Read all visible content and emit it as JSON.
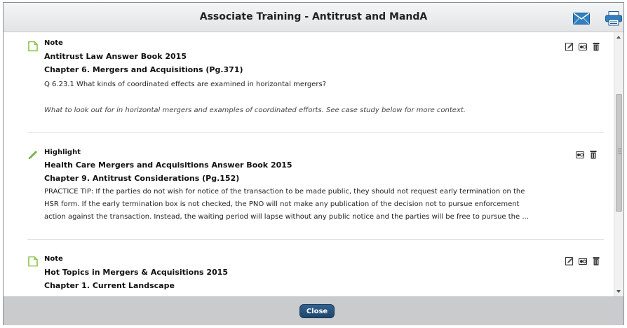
{
  "dialog": {
    "title": "Associate Training - Antitrust and MandA",
    "icons": {
      "email": "mail-icon",
      "print": "printer-icon"
    }
  },
  "entries": [
    {
      "type": "Note",
      "icon": "note-icon",
      "book": "Antitrust Law Answer Book 2015",
      "chapter": "Chapter 6. Mergers and Acquisitions (Pg.371)",
      "quote_lines": [
        "Q 6.23.1 What kinds of coordinated effects are examined in horizontal mergers?"
      ],
      "comment": "What to look out for in horizontal mergers and examples of coordinated efforts. See case study below for more context.",
      "actions": [
        "edit-icon",
        "view-icon",
        "delete-icon"
      ]
    },
    {
      "type": "Highlight",
      "icon": "highlighter-icon",
      "book": "Health Care Mergers and Acquisitions Answer Book 2015",
      "chapter": "Chapter 9. Antitrust Considerations (Pg.152)",
      "quote_lines": [
        "PRACTICE TIP: If the parties do not wish for notice of the transaction to be made public, they should not request early termination on the",
        "HSR form. If the early termination box is not checked, the PNO will not make any publication of the decision not to pursue enforcement",
        "action against the transaction. Instead, the waiting period will lapse without any public notice and the parties will be free to pursue the ..."
      ],
      "actions": [
        "view-icon",
        "delete-icon"
      ]
    },
    {
      "type": "Note",
      "icon": "note-icon",
      "book": "Hot Topics in Mergers & Acquisitions 2015",
      "chapter": "Chapter 1. Current Landscape",
      "actions": [
        "edit-icon",
        "view-icon",
        "delete-icon"
      ]
    }
  ],
  "footer": {
    "close_label": "Close"
  },
  "colors": {
    "accent": "#1f4a75",
    "note_icon": "#8bc34a",
    "highlight_icon": "#7cb342"
  }
}
